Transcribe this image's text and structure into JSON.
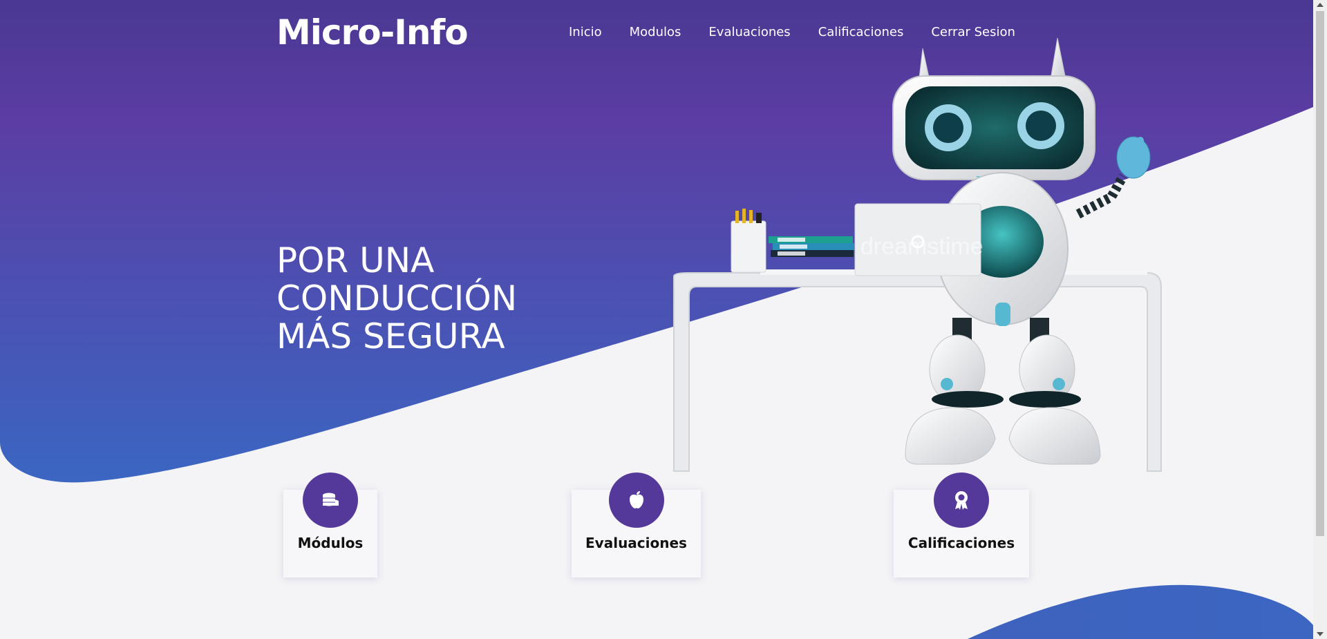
{
  "brand": {
    "title": "Micro-Info"
  },
  "nav": {
    "items": [
      "Inicio",
      "Modulos",
      "Evaluaciones",
      "Calificaciones",
      "Cerrar Sesion"
    ]
  },
  "hero": {
    "lines": [
      "POR UNA",
      "CONDUCCIÓN",
      "MÁS SEGURA"
    ]
  },
  "cards": [
    {
      "label": "Módulos",
      "icon": "coins-stack-icon"
    },
    {
      "label": "Evaluaciones",
      "icon": "apple-icon"
    },
    {
      "label": "Calificaciones",
      "icon": "award-ribbon-icon"
    }
  ],
  "illustration": {
    "watermark": "dreamstime"
  },
  "colors": {
    "gradient_top": "#4f3a9a",
    "gradient_mid": "#5a3ea3",
    "gradient_bottom": "#3e64c0",
    "card_circle": "#55399a",
    "page_bg": "#f4f4f6"
  }
}
